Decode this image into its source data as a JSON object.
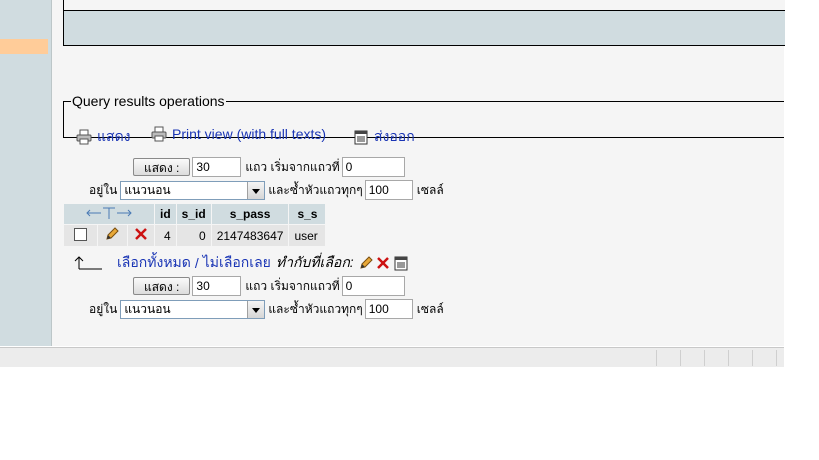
{
  "qro": {
    "legend": "Query results operations",
    "show_link": "แสดง",
    "print_link": "Print view (with full texts)",
    "export_link": "ส่งออก"
  },
  "nav_top": {
    "show_button": "แสดง :",
    "rows_value": "30",
    "rows_label": "แถว เริ่มจากแถวที่",
    "start_value": "0",
    "mode_label": "อยู่ใน",
    "mode_value": "แนวนอน",
    "repeat_label": "และซ้ำหัวแถวทุกๆ",
    "repeat_value": "100",
    "cells_label": "เซลล์"
  },
  "table": {
    "columns": [
      "id",
      "s_id",
      "s_pass",
      "s_s"
    ],
    "rows": [
      {
        "id": "4",
        "s_id": "0",
        "s_pass": "2147483647",
        "s_s": "user"
      }
    ]
  },
  "bulk": {
    "check_all": "เลือกทั้งหมด",
    "separator": "/",
    "uncheck_all": "ไม่เลือกเลย",
    "with_selected": "ทำกับที่เลือก:"
  },
  "nav_bottom": {
    "show_button": "แสดง :",
    "rows_value": "30",
    "rows_label": "แถว เริ่มจากแถวที่",
    "start_value": "0",
    "mode_label": "อยู่ใน",
    "mode_value": "แนวนอน",
    "repeat_label": "และซ้ำหัวแถวทุกๆ",
    "repeat_value": "100",
    "cells_label": "เซลล์"
  },
  "colors": {
    "link": "#1a35b5",
    "header_bg": "#d0dce0",
    "row_bg": "#e5e5e5",
    "left_highlight": "#ffcc99"
  }
}
